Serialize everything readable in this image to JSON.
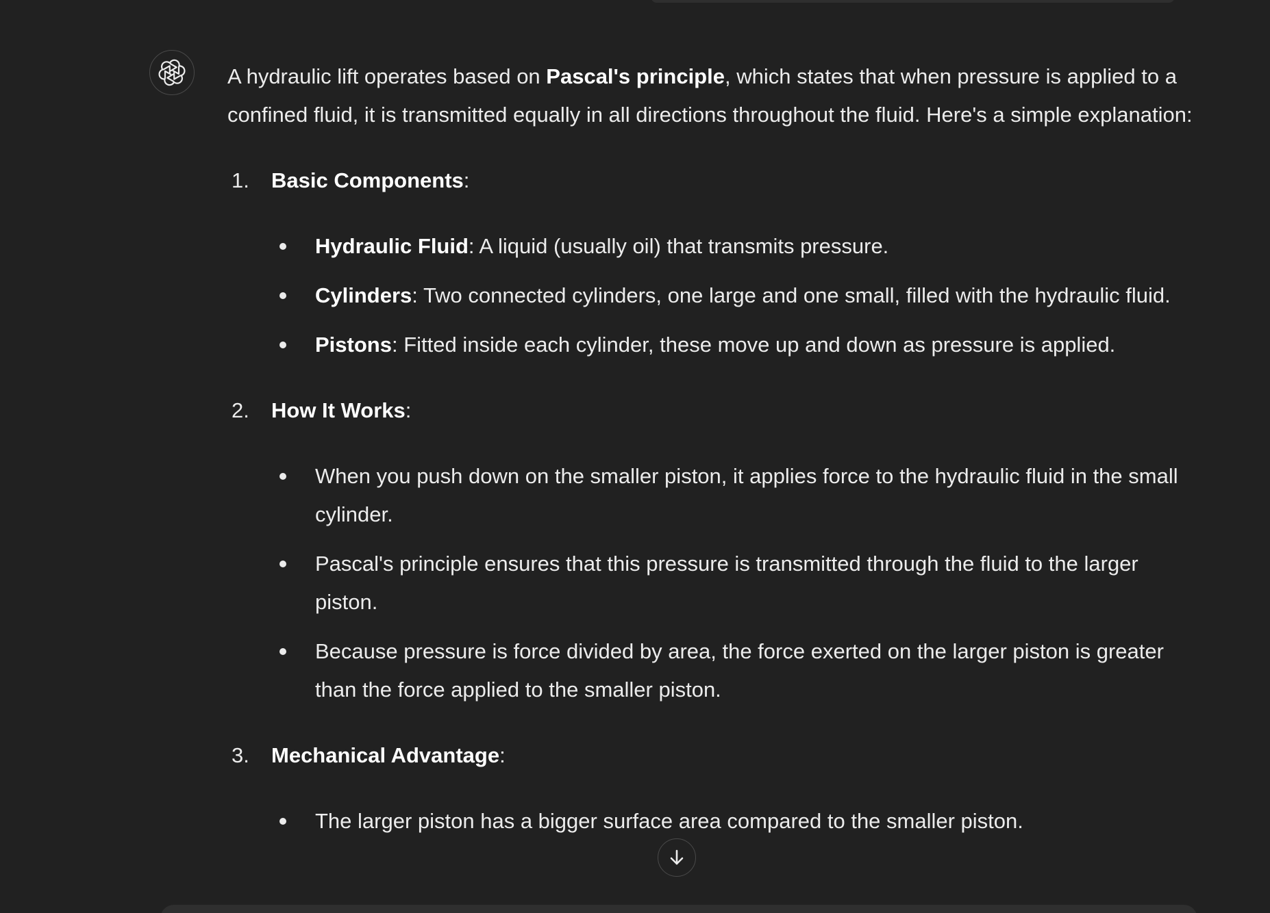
{
  "assistant": {
    "avatar_icon": "openai-logo-icon"
  },
  "message": {
    "intro": {
      "before": "A hydraulic lift operates based on ",
      "bold": "Pascal's principle",
      "after": ", which states that when pressure is applied to a confined fluid, it is transmitted equally in all directions throughout the fluid. Here's a simple explanation:"
    },
    "sections": [
      {
        "number": "1.",
        "title": "Basic Components",
        "colon": ":",
        "bullets": [
          {
            "bold": "Hydraulic Fluid",
            "text": ": A liquid (usually oil) that transmits pressure."
          },
          {
            "bold": "Cylinders",
            "text": ": Two connected cylinders, one large and one small, filled with the hydraulic fluid."
          },
          {
            "bold": "Pistons",
            "text": ": Fitted inside each cylinder, these move up and down as pressure is applied."
          }
        ]
      },
      {
        "number": "2.",
        "title": "How It Works",
        "colon": ":",
        "bullets": [
          {
            "bold": "",
            "text": "When you push down on the smaller piston, it applies force to the hydraulic fluid in the small cylinder."
          },
          {
            "bold": "",
            "text": "Pascal's principle ensures that this pressure is transmitted through the fluid to the larger piston."
          },
          {
            "bold": "",
            "text": "Because pressure is force divided by area, the force exerted on the larger piston is greater than the force applied to the smaller piston."
          }
        ]
      },
      {
        "number": "3.",
        "title": "Mechanical Advantage",
        "colon": ":",
        "bullets": [
          {
            "bold": "",
            "text": "The larger piston has a bigger surface area compared to the smaller piston."
          }
        ]
      }
    ]
  },
  "scroll_down_icon": "arrow-down-icon"
}
